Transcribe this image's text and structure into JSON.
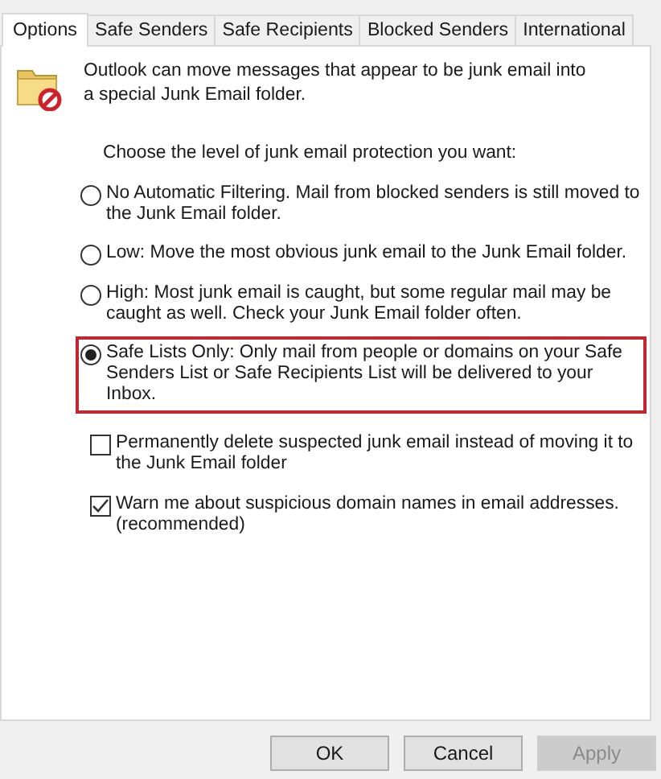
{
  "tabs": [
    {
      "label": "Options",
      "selected": true
    },
    {
      "label": "Safe Senders",
      "selected": false
    },
    {
      "label": "Safe Recipients",
      "selected": false
    },
    {
      "label": "Blocked Senders",
      "selected": false
    },
    {
      "label": "International",
      "selected": false
    }
  ],
  "intro": "Outlook can move messages that appear to be junk email into a special Junk Email folder.",
  "prompt": "Choose the level of junk email protection you want:",
  "levels": [
    {
      "label": "No Automatic Filtering. Mail from blocked senders is still moved to the Junk Email folder.",
      "selected": false,
      "highlighted": false
    },
    {
      "label": "Low: Move the most obvious junk email to the Junk Email folder.",
      "selected": false,
      "highlighted": false
    },
    {
      "label": "High: Most junk email is caught, but some regular mail may be caught as well. Check your Junk Email folder often.",
      "selected": false,
      "highlighted": false
    },
    {
      "label": "Safe Lists Only: Only mail from people or domains on your Safe Senders List or Safe Recipients List will be delivered to your Inbox.",
      "selected": true,
      "highlighted": true
    }
  ],
  "options": [
    {
      "label": "Permanently delete suspected junk email instead of moving it to the Junk Email folder",
      "checked": false
    },
    {
      "label": "Warn me about suspicious domain names in email addresses. (recommended)",
      "checked": true
    }
  ],
  "buttons": [
    {
      "label": "OK",
      "disabled": false
    },
    {
      "label": "Cancel",
      "disabled": false
    },
    {
      "label": "Apply",
      "disabled": true
    }
  ]
}
